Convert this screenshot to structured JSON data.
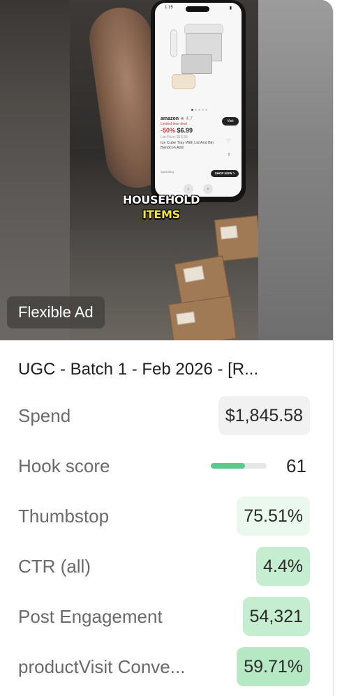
{
  "media": {
    "badge": "Flexible Ad",
    "caption_line1": "HOUSEHOLD",
    "caption_line2": "ITEMS",
    "phone": {
      "time": "1:15",
      "brand": "amazon",
      "rating": "4.7",
      "discount_badge": "Limited time deal",
      "discount": "-50%",
      "price": "$6.99",
      "list_price": "List Price: $13.99",
      "product_title": "Ice Cube Tray With Lid And Bin Bandcon Add",
      "visit_button": "Visit",
      "footer": "Spending",
      "shop_button": "SHOP NOW >",
      "nav_home": "Home",
      "nav_search": "Search"
    }
  },
  "ad": {
    "title": "UGC - Batch 1 - Feb 2026 - [R...",
    "metrics": [
      {
        "label": "Spend",
        "value": "$1,845.58",
        "style": "neutral"
      },
      {
        "label": "Hook score",
        "value": "61",
        "progress": 0.61
      },
      {
        "label": "Thumbstop",
        "value": "75.51%",
        "style": "g1"
      },
      {
        "label": "CTR (all)",
        "value": "4.4%",
        "style": "g2"
      },
      {
        "label": "Post Engagement",
        "value": "54,321",
        "style": "g2"
      },
      {
        "label": "productVisit Conve...",
        "value": "59.71%",
        "style": "g3"
      }
    ]
  },
  "colors": {
    "progress_fill": "#5cc98b",
    "pill_light_green": "#eaf8ee",
    "pill_green": "#c5edd0",
    "pill_neutral": "#f1f1f1"
  }
}
